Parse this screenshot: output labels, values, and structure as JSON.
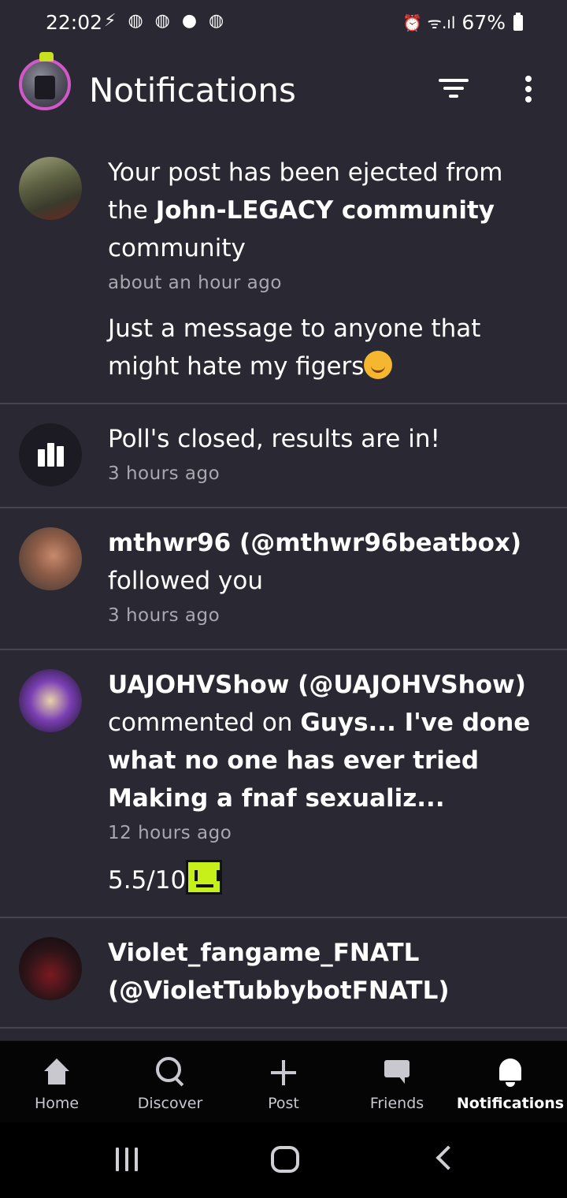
{
  "status_bar": {
    "time": "22:02",
    "left_icons": "⚡ ◍ ◍ ● ◍",
    "right_icons": "⏰ ᯤ.ıl",
    "battery": "67%"
  },
  "header": {
    "title": "Notifications"
  },
  "notifications": [
    {
      "pre": "Your post has been ejected from the ",
      "strong": "John-LEGACY community",
      "post": " community",
      "time": "about an hour ago",
      "message": "Just a message to anyone that might hate my figers",
      "emoji": "smiling-face-emoji"
    },
    {
      "text": "Poll's closed, results are in!",
      "time": "3 hours ago"
    },
    {
      "strong": "mthwr96 (@mthwr96beatbox)",
      "post": " followed you",
      "time": "3 hours ago"
    },
    {
      "strong": "UAJOHVShow (@UAJOHVShow)",
      "mid": " commented on ",
      "strong2": "Guys... I've done what no one has ever tried Making a fnaf sexualiz...",
      "time": "12 hours ago",
      "message": "5.5/10",
      "sticker": "green-face-sticker"
    },
    {
      "strong": "Violet_fangame_FNATL (@VioletTubbybotFNATL)"
    }
  ],
  "bottom_nav": [
    {
      "label": "Home",
      "icon": "home-icon",
      "active": false
    },
    {
      "label": "Discover",
      "icon": "search-icon",
      "active": false
    },
    {
      "label": "Post",
      "icon": "plus-icon",
      "active": false
    },
    {
      "label": "Friends",
      "icon": "chat-icon",
      "active": false
    },
    {
      "label": "Notifications",
      "icon": "bell-icon",
      "active": true
    }
  ],
  "colors": {
    "background": "#2a2833",
    "divider": "#46444f",
    "secondary_text": "#a9a8b0",
    "nav_background": "#050506",
    "avatar_ring": "#d257c8"
  }
}
